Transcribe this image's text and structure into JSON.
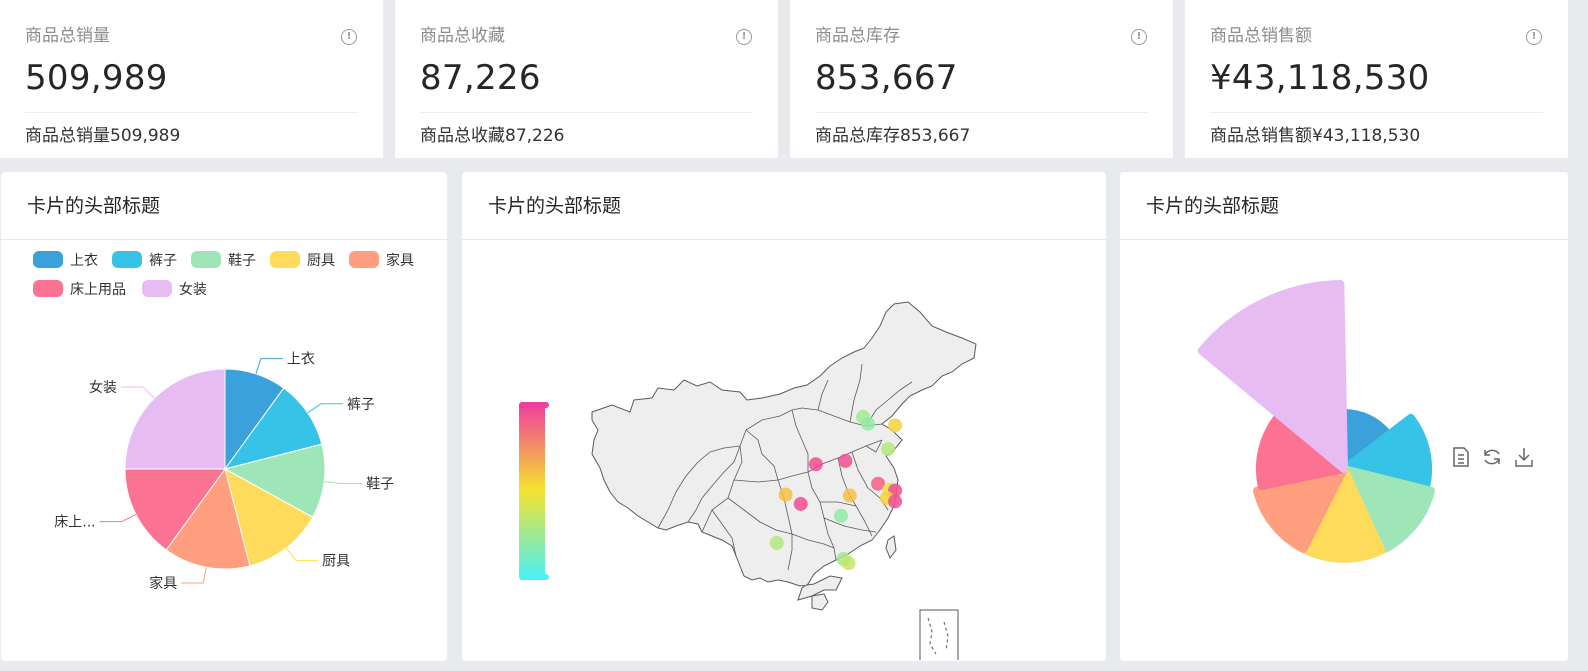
{
  "stats": [
    {
      "title": "商品总销量",
      "value": "509,989",
      "footer": "商品总销量509,989"
    },
    {
      "title": "商品总收藏",
      "value": "87,226",
      "footer": "商品总收藏87,226"
    },
    {
      "title": "商品总库存",
      "value": "853,667",
      "footer": "商品总库存853,667"
    },
    {
      "title": "商品总销售额",
      "value": "¥43,118,530",
      "footer": "商品总销售额¥43,118,530"
    }
  ],
  "cards": [
    {
      "title": "卡片的头部标题"
    },
    {
      "title": "卡片的头部标题"
    },
    {
      "title": "卡片的头部标题"
    }
  ],
  "colors": {
    "上衣": "#3ba1da",
    "裤子": "#37c3e8",
    "鞋子": "#9ee6b7",
    "厨具": "#ffdb5c",
    "家具": "#ff9f7f",
    "床上用品": "#fb7293",
    "女装": "#e7bcf3"
  },
  "chart_data": [
    {
      "type": "pie",
      "legend": [
        "上衣",
        "裤子",
        "鞋子",
        "厨具",
        "家具",
        "床上用品",
        "女装"
      ],
      "legend_position": "top-left",
      "slices": [
        {
          "name": "上衣",
          "label": "上衣",
          "value": 10
        },
        {
          "name": "裤子",
          "label": "裤子",
          "value": 11
        },
        {
          "name": "鞋子",
          "label": "鞋子",
          "value": 12
        },
        {
          "name": "厨具",
          "label": "厨具",
          "value": 13
        },
        {
          "name": "家具",
          "label": "家具",
          "value": 14
        },
        {
          "name": "床上用品",
          "label": "床上...",
          "value": 15
        },
        {
          "name": "女装",
          "label": "女装",
          "value": 25
        }
      ]
    },
    {
      "type": "scatter",
      "points": [
        {
          "lon": 116.4,
          "lat": 39.9,
          "value": 0.75
        },
        {
          "lon": 117.2,
          "lat": 39.1,
          "value": 0.8
        },
        {
          "lon": 121.5,
          "lat": 38.9,
          "value": 0.45
        },
        {
          "lon": 120.4,
          "lat": 36.1,
          "value": 0.7
        },
        {
          "lon": 113.6,
          "lat": 34.7,
          "value": 0.05
        },
        {
          "lon": 108.9,
          "lat": 34.3,
          "value": 0.05
        },
        {
          "lon": 118.8,
          "lat": 32.0,
          "value": 0.1
        },
        {
          "lon": 120.6,
          "lat": 31.3,
          "value": 0.55
        },
        {
          "lon": 121.5,
          "lat": 31.2,
          "value": 0.05
        },
        {
          "lon": 120.2,
          "lat": 30.3,
          "value": 0.45
        },
        {
          "lon": 121.5,
          "lat": 29.9,
          "value": 0.05
        },
        {
          "lon": 114.3,
          "lat": 30.6,
          "value": 0.4
        },
        {
          "lon": 104.1,
          "lat": 30.7,
          "value": 0.4
        },
        {
          "lon": 106.5,
          "lat": 29.6,
          "value": 0.05
        },
        {
          "lon": 112.9,
          "lat": 28.2,
          "value": 0.8
        },
        {
          "lon": 102.7,
          "lat": 25.0,
          "value": 0.7
        },
        {
          "lon": 113.3,
          "lat": 23.1,
          "value": 0.75
        },
        {
          "lon": 114.1,
          "lat": 22.6,
          "value": 0.65
        }
      ],
      "visual_map": {
        "min_color": "#50f0f0",
        "mid_color": "#f5e22e",
        "max_color": "#f03e9d"
      }
    },
    {
      "type": "pie",
      "subtype": "rose",
      "toolbox": [
        "data-view-icon",
        "restore-icon",
        "save-image-icon"
      ],
      "slices": [
        {
          "name": "上衣",
          "value": 10
        },
        {
          "name": "裤子",
          "value": 15
        },
        {
          "name": "鞋子",
          "value": 16
        },
        {
          "name": "厨具",
          "value": 16
        },
        {
          "name": "家具",
          "value": 16
        },
        {
          "name": "床上用品",
          "value": 15
        },
        {
          "name": "女装",
          "value": 33
        }
      ]
    }
  ]
}
